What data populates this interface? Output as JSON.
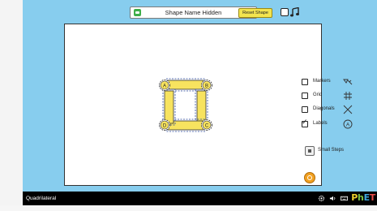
{
  "header": {
    "shape_name_toggle": "Shape Name Hidden",
    "reset_label": "Reset Shape"
  },
  "quadrilateral": {
    "vertex_labels": [
      "A",
      "B",
      "C",
      "D"
    ]
  },
  "controls": [
    {
      "label": "Markers",
      "checked": false,
      "icon": "markers-icon"
    },
    {
      "label": "Grid",
      "checked": false,
      "icon": "grid-icon"
    },
    {
      "label": "Diagonals",
      "checked": false,
      "icon": "diagonals-icon"
    },
    {
      "label": "Labels",
      "checked": true,
      "icon": "labels-icon"
    }
  ],
  "small_steps": {
    "label": "Small Steps"
  },
  "nav": {
    "title": "Quadrilateral"
  },
  "colors": {
    "background": "#87cdee",
    "side_fill": "#f7e35f",
    "reset_button": "#f3e44f",
    "nav_bar": "#000000"
  }
}
